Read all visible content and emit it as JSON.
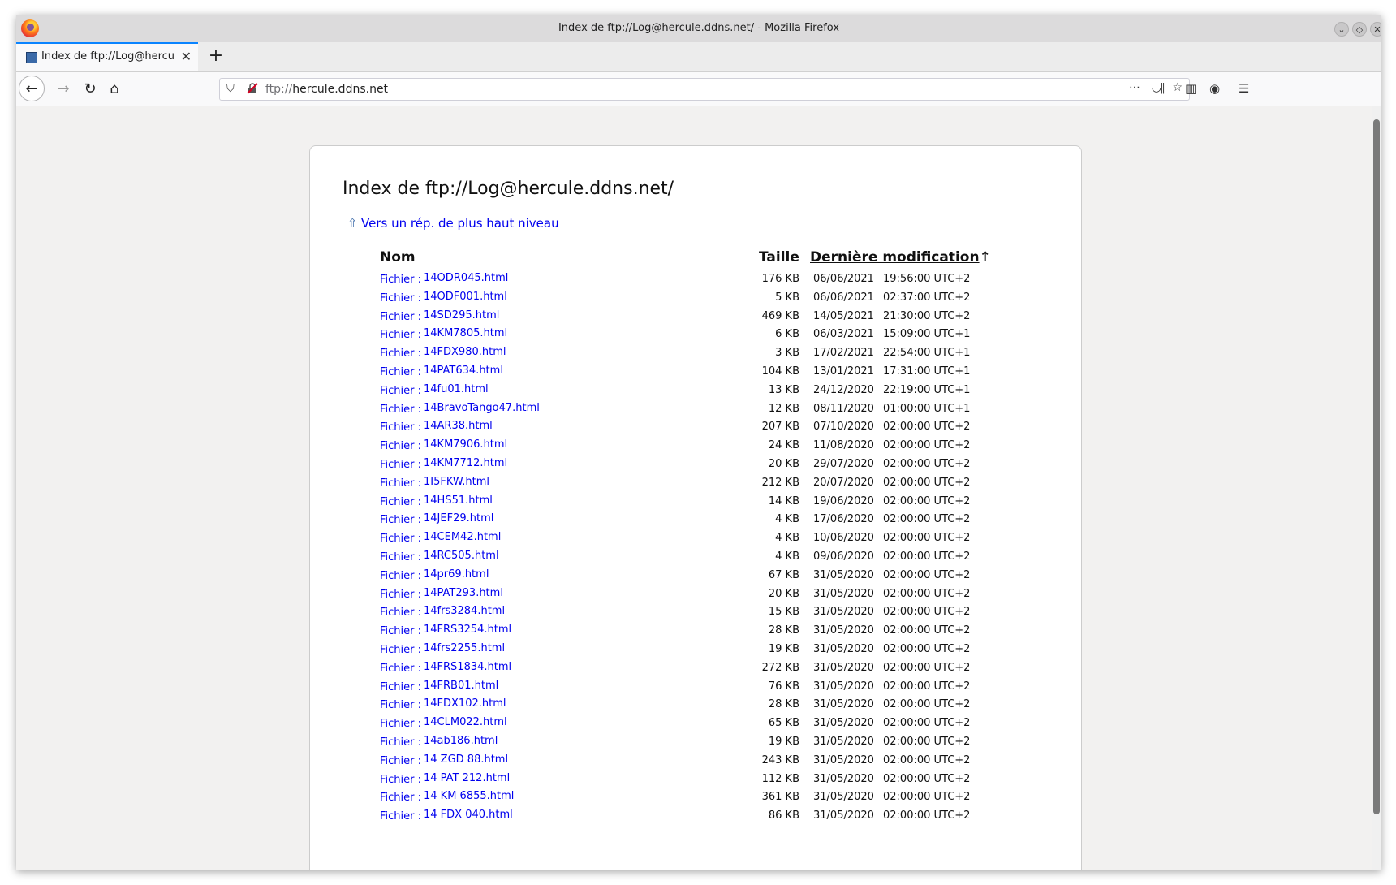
{
  "window": {
    "title": "Index de ftp://Log@hercule.ddns.net/ - Mozilla Firefox"
  },
  "tab": {
    "title": "Index de ftp://Log@hercule",
    "close": "✕"
  },
  "newtab": "+",
  "urlbar": {
    "scheme": "ftp://",
    "host": "hercule.ddns.net"
  },
  "page": {
    "title": "Index de ftp://Log@hercule.ddns.net/",
    "up_link": "Vers un rép. de plus haut niveau",
    "headers": {
      "name": "Nom",
      "size": "Taille",
      "modified": "Dernière modification",
      "sort_arrow": "↑"
    }
  },
  "files": [
    {
      "kind": "Fichier :",
      "name": "14ODR045.html",
      "size": "176 KB",
      "date": "06/06/2021",
      "time": "19:56:00 UTC+2"
    },
    {
      "kind": "Fichier :",
      "name": "14ODF001.html",
      "size": "5 KB",
      "date": "06/06/2021",
      "time": "02:37:00 UTC+2"
    },
    {
      "kind": "Fichier :",
      "name": "14SD295.html",
      "size": "469 KB",
      "date": "14/05/2021",
      "time": "21:30:00 UTC+2"
    },
    {
      "kind": "Fichier :",
      "name": "14KM7805.html",
      "size": "6 KB",
      "date": "06/03/2021",
      "time": "15:09:00 UTC+1"
    },
    {
      "kind": "Fichier :",
      "name": "14FDX980.html",
      "size": "3 KB",
      "date": "17/02/2021",
      "time": "22:54:00 UTC+1"
    },
    {
      "kind": "Fichier :",
      "name": "14PAT634.html",
      "size": "104 KB",
      "date": "13/01/2021",
      "time": "17:31:00 UTC+1"
    },
    {
      "kind": "Fichier :",
      "name": "14fu01.html",
      "size": "13 KB",
      "date": "24/12/2020",
      "time": "22:19:00 UTC+1"
    },
    {
      "kind": "Fichier :",
      "name": "14BravoTango47.html",
      "size": "12 KB",
      "date": "08/11/2020",
      "time": "01:00:00 UTC+1"
    },
    {
      "kind": "Fichier :",
      "name": "14AR38.html",
      "size": "207 KB",
      "date": "07/10/2020",
      "time": "02:00:00 UTC+2"
    },
    {
      "kind": "Fichier :",
      "name": "14KM7906.html",
      "size": "24 KB",
      "date": "11/08/2020",
      "time": "02:00:00 UTC+2"
    },
    {
      "kind": "Fichier :",
      "name": "14KM7712.html",
      "size": "20 KB",
      "date": "29/07/2020",
      "time": "02:00:00 UTC+2"
    },
    {
      "kind": "Fichier :",
      "name": "1I5FKW.html",
      "size": "212 KB",
      "date": "20/07/2020",
      "time": "02:00:00 UTC+2"
    },
    {
      "kind": "Fichier :",
      "name": "14HS51.html",
      "size": "14 KB",
      "date": "19/06/2020",
      "time": "02:00:00 UTC+2"
    },
    {
      "kind": "Fichier :",
      "name": "14JEF29.html",
      "size": "4 KB",
      "date": "17/06/2020",
      "time": "02:00:00 UTC+2"
    },
    {
      "kind": "Fichier :",
      "name": "14CEM42.html",
      "size": "4 KB",
      "date": "10/06/2020",
      "time": "02:00:00 UTC+2"
    },
    {
      "kind": "Fichier :",
      "name": "14RC505.html",
      "size": "4 KB",
      "date": "09/06/2020",
      "time": "02:00:00 UTC+2"
    },
    {
      "kind": "Fichier :",
      "name": "14pr69.html",
      "size": "67 KB",
      "date": "31/05/2020",
      "time": "02:00:00 UTC+2"
    },
    {
      "kind": "Fichier :",
      "name": "14PAT293.html",
      "size": "20 KB",
      "date": "31/05/2020",
      "time": "02:00:00 UTC+2"
    },
    {
      "kind": "Fichier :",
      "name": "14frs3284.html",
      "size": "15 KB",
      "date": "31/05/2020",
      "time": "02:00:00 UTC+2"
    },
    {
      "kind": "Fichier :",
      "name": "14FRS3254.html",
      "size": "28 KB",
      "date": "31/05/2020",
      "time": "02:00:00 UTC+2"
    },
    {
      "kind": "Fichier :",
      "name": "14frs2255.html",
      "size": "19 KB",
      "date": "31/05/2020",
      "time": "02:00:00 UTC+2"
    },
    {
      "kind": "Fichier :",
      "name": "14FRS1834.html",
      "size": "272 KB",
      "date": "31/05/2020",
      "time": "02:00:00 UTC+2"
    },
    {
      "kind": "Fichier :",
      "name": "14FRB01.html",
      "size": "76 KB",
      "date": "31/05/2020",
      "time": "02:00:00 UTC+2"
    },
    {
      "kind": "Fichier :",
      "name": "14FDX102.html",
      "size": "28 KB",
      "date": "31/05/2020",
      "time": "02:00:00 UTC+2"
    },
    {
      "kind": "Fichier :",
      "name": "14CLM022.html",
      "size": "65 KB",
      "date": "31/05/2020",
      "time": "02:00:00 UTC+2"
    },
    {
      "kind": "Fichier :",
      "name": "14ab186.html",
      "size": "19 KB",
      "date": "31/05/2020",
      "time": "02:00:00 UTC+2"
    },
    {
      "kind": "Fichier :",
      "name": "14 ZGD 88.html",
      "size": "243 KB",
      "date": "31/05/2020",
      "time": "02:00:00 UTC+2"
    },
    {
      "kind": "Fichier :",
      "name": "14 PAT 212.html",
      "size": "112 KB",
      "date": "31/05/2020",
      "time": "02:00:00 UTC+2"
    },
    {
      "kind": "Fichier :",
      "name": "14 KM 6855.html",
      "size": "361 KB",
      "date": "31/05/2020",
      "time": "02:00:00 UTC+2"
    },
    {
      "kind": "Fichier :",
      "name": "14 FDX 040.html",
      "size": "86 KB",
      "date": "31/05/2020",
      "time": "02:00:00 UTC+2"
    }
  ]
}
